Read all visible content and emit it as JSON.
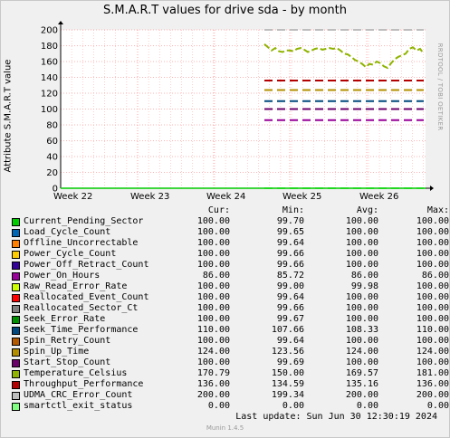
{
  "title": "S.M.A.R.T values for drive sda - by month",
  "watermark": "RRDTOOL / TOBI OETIKER",
  "footer": {
    "last_update": "Last update:  Sun Jun 30 12:30:19 2024",
    "munin": "Munin 1.4.5"
  },
  "legend_headers": {
    "cur": "Cur:",
    "min": "Min:",
    "avg": "Avg:",
    "max": "Max:"
  },
  "chart_data": {
    "type": "line",
    "title": "S.M.A.R.T values for drive sda - by month",
    "xlabel": "",
    "ylabel": "Attribute S.M.A.R.T value",
    "ylim": [
      0,
      200
    ],
    "yticks": [
      "0",
      "20",
      "40",
      "60",
      "80",
      "100",
      "120",
      "140",
      "160",
      "180",
      "200"
    ],
    "xticks": [
      "Week 22",
      "Week 23",
      "Week 24",
      "Week 25",
      "Week 26"
    ],
    "grid": true,
    "legend_position": "bottom",
    "series": [
      {
        "name": "Current_Pending_Sector",
        "color": "#00cc00",
        "cur": "100.00",
        "min": "99.70",
        "avg": "100.00",
        "max": "100.00"
      },
      {
        "name": "Load_Cycle_Count",
        "color": "#0066b3",
        "cur": "100.00",
        "min": "99.65",
        "avg": "100.00",
        "max": "100.00"
      },
      {
        "name": "Offline_Uncorrectable",
        "color": "#ff8000",
        "cur": "100.00",
        "min": "99.64",
        "avg": "100.00",
        "max": "100.00"
      },
      {
        "name": "Power_Cycle_Count",
        "color": "#ffcc00",
        "cur": "100.00",
        "min": "99.66",
        "avg": "100.00",
        "max": "100.00"
      },
      {
        "name": "Power_Off_Retract_Count",
        "color": "#330099",
        "cur": "100.00",
        "min": "99.66",
        "avg": "100.00",
        "max": "100.00"
      },
      {
        "name": "Power_On_Hours",
        "color": "#990099",
        "cur": "86.00",
        "min": "85.72",
        "avg": "86.00",
        "max": "86.00"
      },
      {
        "name": "Raw_Read_Error_Rate",
        "color": "#ccff00",
        "cur": "100.00",
        "min": "99.00",
        "avg": "99.98",
        "max": "100.00"
      },
      {
        "name": "Reallocated_Event_Count",
        "color": "#ff0000",
        "cur": "100.00",
        "min": "99.64",
        "avg": "100.00",
        "max": "100.00"
      },
      {
        "name": "Reallocated_Sector_Ct",
        "color": "#808080",
        "cur": "100.00",
        "min": "99.66",
        "avg": "100.00",
        "max": "100.00"
      },
      {
        "name": "Seek_Error_Rate",
        "color": "#008f00",
        "cur": "100.00",
        "min": "99.67",
        "avg": "100.00",
        "max": "100.00"
      },
      {
        "name": "Seek_Time_Performance",
        "color": "#00487d",
        "cur": "110.00",
        "min": "107.66",
        "avg": "108.33",
        "max": "110.00"
      },
      {
        "name": "Spin_Retry_Count",
        "color": "#b35a00",
        "cur": "100.00",
        "min": "99.64",
        "avg": "100.00",
        "max": "100.00"
      },
      {
        "name": "Spin_Up_Time",
        "color": "#b38f00",
        "cur": "124.00",
        "min": "123.56",
        "avg": "124.00",
        "max": "124.00"
      },
      {
        "name": "Start_Stop_Count",
        "color": "#6b006b",
        "cur": "100.00",
        "min": "99.69",
        "avg": "100.00",
        "max": "100.00"
      },
      {
        "name": "Temperature_Celsius",
        "color": "#8fb300",
        "cur": "170.79",
        "min": "150.00",
        "avg": "169.57",
        "max": "181.00"
      },
      {
        "name": "Throughput_Performance",
        "color": "#b30000",
        "cur": "136.00",
        "min": "134.59",
        "avg": "135.16",
        "max": "136.00"
      },
      {
        "name": "UDMA_CRC_Error_Count",
        "color": "#bebebe",
        "cur": "200.00",
        "min": "199.34",
        "avg": "200.00",
        "max": "200.00"
      },
      {
        "name": "smartctl_exit_status",
        "color": "#80ff80",
        "cur": "0.00",
        "min": "0.00",
        "avg": "0.00",
        "max": "0.00"
      }
    ]
  }
}
